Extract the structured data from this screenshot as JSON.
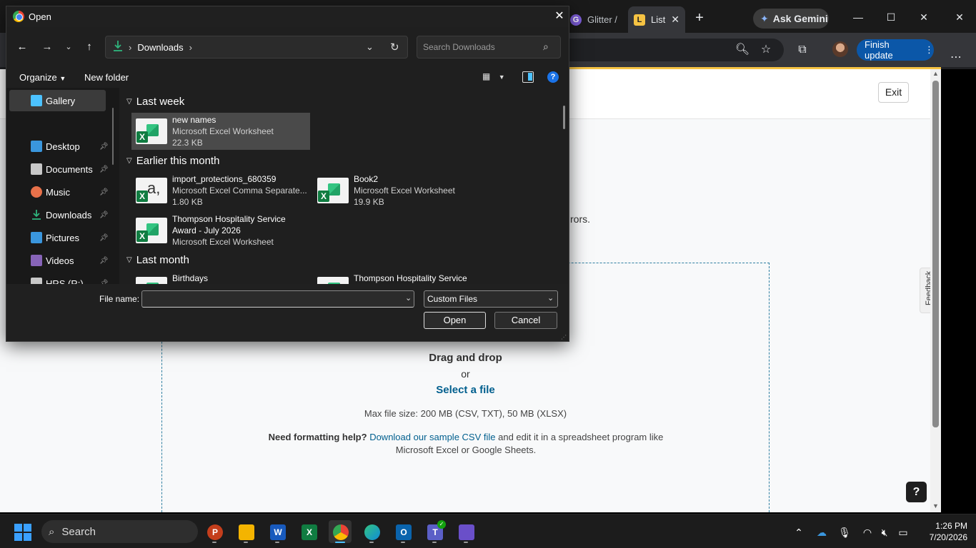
{
  "browser": {
    "tabs": [
      {
        "label": "Glitter /",
        "icon": "glitter-icon"
      },
      {
        "label": "List",
        "icon": "list-icon",
        "active": true
      }
    ],
    "gemini_label": "Ask Gemini",
    "finish_update_label": "Finish update"
  },
  "page": {
    "exit_label": "Exit",
    "errors_fragment": "rors.",
    "dropzone": {
      "title": "Drag and drop",
      "or": "or",
      "select_file": "Select a file",
      "max_size": "Max file size: 200 MB (CSV, TXT), 50 MB (XLSX)",
      "help_prefix": "Need formatting help?",
      "help_link": "Download our sample CSV file",
      "help_suffix": "and edit it in a spreadsheet program like Microsoft Excel or Google Sheets."
    },
    "feedback_label": "Feedback",
    "help_button": "?"
  },
  "dialog": {
    "title": "Open",
    "breadcrumb": [
      "Downloads"
    ],
    "search_placeholder": "Search Downloads",
    "organize_label": "Organize",
    "new_folder_label": "New folder",
    "nav_items": [
      {
        "label": "Gallery",
        "icon": "gallery-icon",
        "color": "#4cc2ff",
        "selected": true,
        "pinned": false
      },
      {
        "label": "Desktop",
        "icon": "desktop-icon",
        "color": "#3a96dd",
        "pinned": true
      },
      {
        "label": "Documents",
        "icon": "documents-icon",
        "color": "#c8c8c8",
        "pinned": true
      },
      {
        "label": "Music",
        "icon": "music-icon",
        "color": "#e8714a",
        "pinned": true
      },
      {
        "label": "Downloads",
        "icon": "downloads-icon",
        "color": "#2fb47c",
        "pinned": true
      },
      {
        "label": "Pictures",
        "icon": "pictures-icon",
        "color": "#3a96dd",
        "pinned": true
      },
      {
        "label": "Videos",
        "icon": "videos-icon",
        "color": "#8764b8",
        "pinned": true
      },
      {
        "label": "HRS (R:)",
        "icon": "drive-icon",
        "color": "#c8c8c8",
        "pinned": true
      }
    ],
    "groups": [
      {
        "title": "Last week"
      },
      {
        "title": "Earlier this month"
      },
      {
        "title": "Last month"
      }
    ],
    "files": [
      {
        "name": "new names",
        "type": "Microsoft Excel Worksheet",
        "size": "22.3 KB"
      },
      {
        "name": "import_protections_680359",
        "type": "Microsoft Excel Comma Separate...",
        "size": "1.80 KB"
      },
      {
        "name": "Book2",
        "type": "Microsoft Excel Worksheet",
        "size": "19.9 KB"
      },
      {
        "name": "Thompson Hospitality Service",
        "type": "Award - July 2026",
        "size": "Microsoft Excel Worksheet"
      },
      {
        "name": "Birthdays",
        "type": "",
        "size": ""
      },
      {
        "name": "Thompson Hospitality Service",
        "type": "",
        "size": ""
      }
    ],
    "file_name_label": "File name:",
    "file_name_value": "",
    "file_type": "Custom Files",
    "open_label": "Open",
    "cancel_label": "Cancel"
  },
  "taskbar": {
    "search_label": "Search",
    "apps": [
      {
        "name": "powerpoint",
        "letter": "P",
        "color": "#c43e1c"
      },
      {
        "name": "file-explorer",
        "letter": "",
        "color": "#f4b400"
      },
      {
        "name": "word",
        "letter": "W",
        "color": "#185abd"
      },
      {
        "name": "excel",
        "letter": "X",
        "color": "#107c41"
      },
      {
        "name": "chrome",
        "letter": "",
        "color": "#4285f4"
      },
      {
        "name": "edge",
        "letter": "",
        "color": "#0f8bd8"
      },
      {
        "name": "outlook",
        "letter": "O",
        "color": "#0a64ad"
      },
      {
        "name": "teams",
        "letter": "T",
        "color": "#5b5fc7"
      },
      {
        "name": "snipping-tool",
        "letter": "",
        "color": "#6a4fc9"
      }
    ],
    "time": "1:26 PM",
    "date": "7/20/2026"
  }
}
